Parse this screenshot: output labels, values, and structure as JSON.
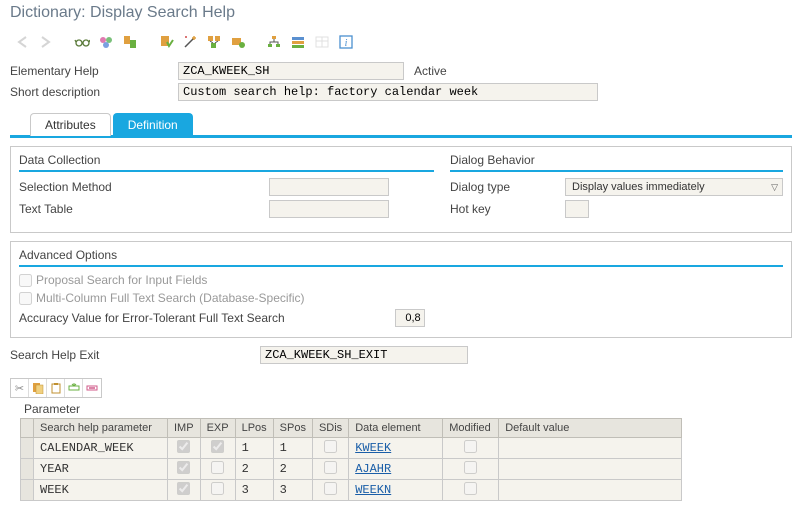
{
  "title": "Dictionary: Display Search Help",
  "header": {
    "elementary_help_label": "Elementary Help",
    "elementary_help_value": "ZCA_KWEEK_SH",
    "status": "Active",
    "short_desc_label": "Short description",
    "short_desc_value": "Custom search help: factory calendar week"
  },
  "tabs": {
    "attributes": "Attributes",
    "definition": "Definition"
  },
  "data_collection": {
    "title": "Data Collection",
    "selection_method_label": "Selection Method",
    "selection_method_value": "",
    "text_table_label": "Text Table",
    "text_table_value": ""
  },
  "dialog_behavior": {
    "title": "Dialog Behavior",
    "dialog_type_label": "Dialog type",
    "dialog_type_value": "Display values immediately",
    "hot_key_label": "Hot key",
    "hot_key_value": ""
  },
  "advanced": {
    "title": "Advanced Options",
    "proposal_label": "Proposal Search for Input Fields",
    "multicol_label": "Multi-Column Full Text Search (Database-Specific)",
    "accuracy_label": "Accuracy Value for Error-Tolerant Full Text Search",
    "accuracy_value": "0,8"
  },
  "exit": {
    "label": "Search Help Exit",
    "value": "ZCA_KWEEK_SH_EXIT"
  },
  "grid": {
    "title": "Parameter",
    "headers": {
      "param": "Search help parameter",
      "imp": "IMP",
      "exp": "EXP",
      "lpos": "LPos",
      "spos": "SPos",
      "sdis": "SDis",
      "data_elem": "Data element",
      "modified": "Modified",
      "default": "Default value"
    },
    "rows": [
      {
        "param": "CALENDAR_WEEK",
        "imp": true,
        "exp": true,
        "lpos": "1",
        "spos": "1",
        "sdis": false,
        "elem": "KWEEK",
        "modified": false,
        "default": ""
      },
      {
        "param": "YEAR",
        "imp": true,
        "exp": false,
        "lpos": "2",
        "spos": "2",
        "sdis": false,
        "elem": "AJAHR",
        "modified": false,
        "default": ""
      },
      {
        "param": "WEEK",
        "imp": true,
        "exp": false,
        "lpos": "3",
        "spos": "3",
        "sdis": false,
        "elem": "WEEKN",
        "modified": false,
        "default": ""
      }
    ]
  }
}
